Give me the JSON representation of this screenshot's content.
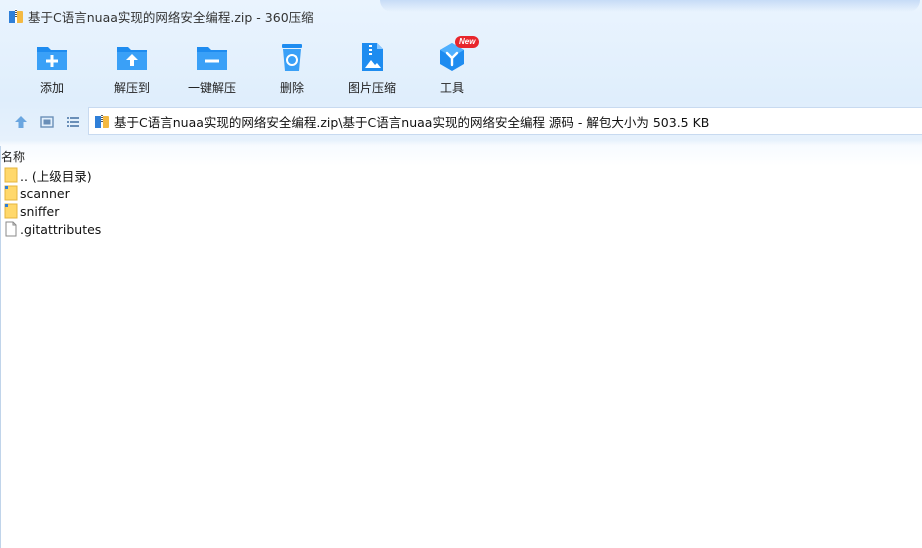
{
  "window": {
    "title": "基于C语言nuaa实现的网络安全编程.zip - 360压缩"
  },
  "toolbar": {
    "items": [
      {
        "id": "add",
        "label": "添加",
        "icon": "folder-add-icon"
      },
      {
        "id": "extract-to",
        "label": "解压到",
        "icon": "folder-extract-icon"
      },
      {
        "id": "one-click-extract",
        "label": "一键解压",
        "icon": "folder-minus-icon"
      },
      {
        "id": "delete",
        "label": "删除",
        "icon": "recycle-bin-icon"
      },
      {
        "id": "image-compress",
        "label": "图片压缩",
        "icon": "image-compress-icon"
      },
      {
        "id": "tools",
        "label": "工具",
        "icon": "tools-cube-icon",
        "badge": "New"
      }
    ]
  },
  "navbar": {
    "address": "基于C语言nuaa实现的网络安全编程.zip\\基于C语言nuaa实现的网络安全编程 源码 - 解包大小为 503.5 KB"
  },
  "list": {
    "column_name": "名称",
    "rows": [
      {
        "name": ".. (上级目录)",
        "type": "parent-folder"
      },
      {
        "name": "scanner",
        "type": "folder"
      },
      {
        "name": "sniffer",
        "type": "folder"
      },
      {
        "name": ".gitattributes",
        "type": "file"
      }
    ]
  },
  "colors": {
    "accent_blue": "#1e8cf0",
    "badge_red": "#e8262c"
  }
}
